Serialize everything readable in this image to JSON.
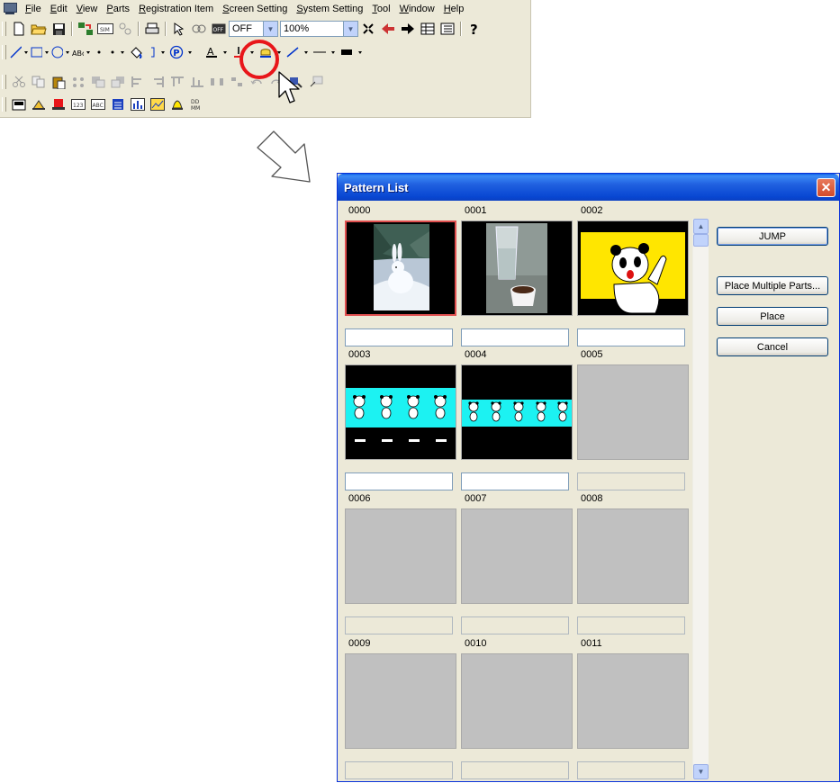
{
  "menubar": {
    "items": [
      "File",
      "Edit",
      "View",
      "Parts",
      "Registration Item",
      "Screen Setting",
      "System Setting",
      "Tool",
      "Window",
      "Help"
    ]
  },
  "toolbar": {
    "off_label": "OFF",
    "zoom_value": "100%",
    "text_tool_label": "ABC"
  },
  "dialog": {
    "title": "Pattern List",
    "close_label": "✕",
    "buttons": {
      "jump": "JUMP",
      "place_multiple": "Place Multiple Parts...",
      "place": "Place",
      "cancel": "Cancel"
    },
    "patterns": [
      {
        "id": "0000",
        "image": "rabbit-in-snow",
        "selected": true
      },
      {
        "id": "0001",
        "image": "glass-and-cup"
      },
      {
        "id": "0002",
        "image": "panda-yellow"
      },
      {
        "id": "0003",
        "image": "pandas-cyan-strip"
      },
      {
        "id": "0004",
        "image": "pandas-cyan-strip-2"
      },
      {
        "id": "0005",
        "image": "empty"
      },
      {
        "id": "0006",
        "image": "empty"
      },
      {
        "id": "0007",
        "image": "empty"
      },
      {
        "id": "0008",
        "image": "empty"
      },
      {
        "id": "0009",
        "image": "empty"
      },
      {
        "id": "0010",
        "image": "empty"
      },
      {
        "id": "0011",
        "image": "empty"
      }
    ]
  },
  "colors": {
    "highlight": "#e8161a",
    "titlebar": "#0a5ee6",
    "panda_bg": "#ffe600",
    "strip": "#1cf2f2"
  }
}
